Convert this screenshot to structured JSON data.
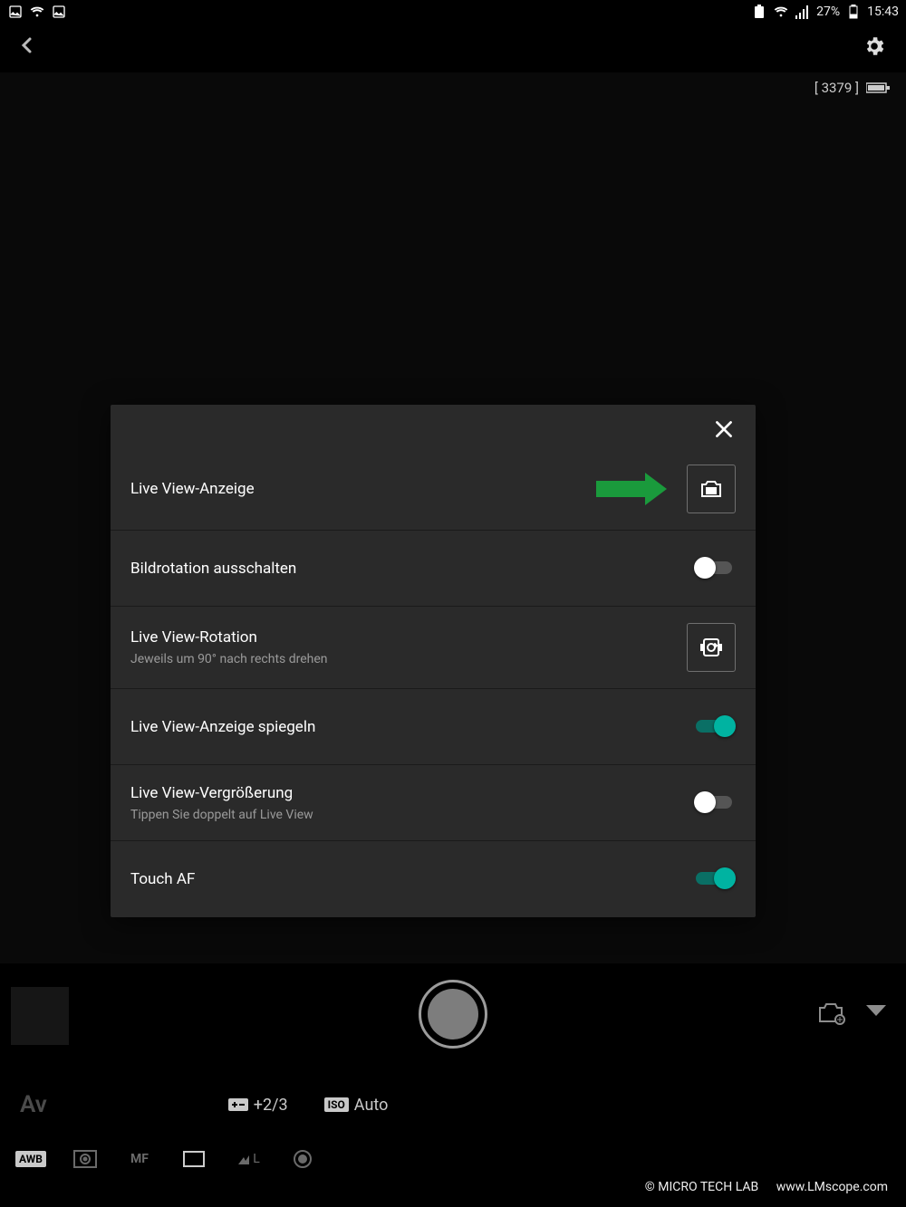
{
  "statusbar": {
    "battery_pct": "27%",
    "time": "15:43"
  },
  "preview": {
    "shot_counter": "[ 3379 ]"
  },
  "modal": {
    "rows": [
      {
        "title": "Live View-Anzeige",
        "sub": ""
      },
      {
        "title": "Bildrotation ausschalten",
        "sub": ""
      },
      {
        "title": "Live View-Rotation",
        "sub": "Jeweils um 90° nach rechts drehen"
      },
      {
        "title": "Live View-Anzeige spiegeln",
        "sub": ""
      },
      {
        "title": "Live View-Vergrößerung",
        "sub": "Tippen Sie doppelt auf Live View"
      },
      {
        "title": "Touch AF",
        "sub": ""
      }
    ]
  },
  "info": {
    "mode": "Av",
    "ev_icon_label": "±",
    "ev_value": "+2/3",
    "iso_label": "ISO",
    "iso_value": "Auto"
  },
  "modes": {
    "awb": "AWB",
    "mf": "MF",
    "quality": "L"
  },
  "watermark": {
    "copyright": "©  MICRO TECH LAB",
    "url": "www.LMscope.com"
  }
}
